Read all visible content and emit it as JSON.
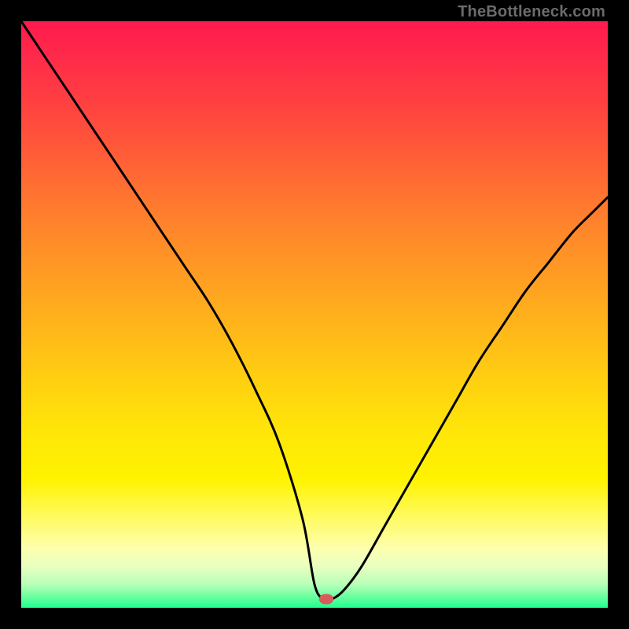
{
  "watermark": "TheBottleneck.com",
  "colors": {
    "frame": "#000000",
    "curve": "#000000",
    "marker": "#d85a5a"
  },
  "chart_data": {
    "type": "line",
    "title": "",
    "xlabel": "",
    "ylabel": "",
    "xlim": [
      0,
      100
    ],
    "ylim": [
      0,
      100
    ],
    "grid": false,
    "legend": false,
    "series": [
      {
        "name": "bottleneck-curve",
        "x": [
          0,
          4,
          8,
          12,
          16,
          20,
          24,
          28,
          32,
          36,
          40,
          44,
          48,
          50,
          51.5,
          53,
          55,
          58,
          62,
          66,
          70,
          74,
          78,
          82,
          86,
          90,
          94,
          98,
          100
        ],
        "y": [
          100,
          94,
          88,
          82,
          76,
          70,
          64,
          58,
          52,
          45,
          37,
          28,
          15,
          4,
          1.5,
          1.5,
          3,
          7,
          14,
          21,
          28,
          35,
          42,
          48,
          54,
          59,
          64,
          68,
          70
        ]
      }
    ],
    "marker": {
      "x": 52,
      "y": 1.5
    },
    "background_gradient": {
      "direction": "vertical",
      "stops": [
        {
          "pos": 0.0,
          "color": "#ff1a4d"
        },
        {
          "pos": 0.5,
          "color": "#ffb018"
        },
        {
          "pos": 0.8,
          "color": "#fff300"
        },
        {
          "pos": 1.0,
          "color": "#1eff90"
        }
      ]
    },
    "note": "Values estimated from pixel positions; no axis ticks or labels present in image."
  }
}
